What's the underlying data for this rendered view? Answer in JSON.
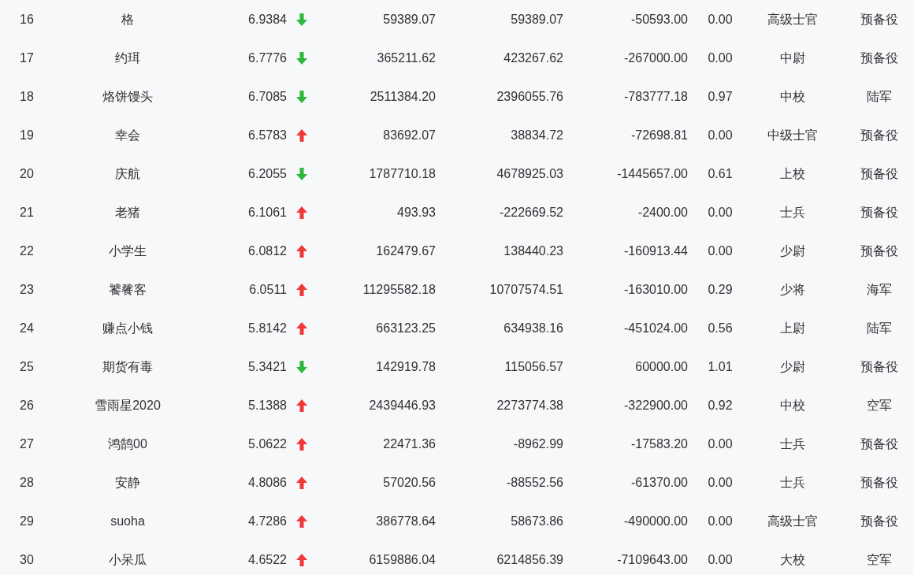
{
  "rows": [
    {
      "rank": "16",
      "name": "格",
      "score": "6.9384",
      "rising": false,
      "column_4": "59389.07",
      "column_5": "59389.07",
      "column_6": "-50593.00",
      "column_7": "0.00",
      "column_8": "高级士官",
      "column_9": "预备役"
    },
    {
      "rank": "17",
      "name": "约珥",
      "score": "6.7776",
      "rising": false,
      "column_4": "365211.62",
      "column_5": "423267.62",
      "column_6": "-267000.00",
      "column_7": "0.00",
      "column_8": "中尉",
      "column_9": "预备役"
    },
    {
      "rank": "18",
      "name": "烙饼馒头",
      "score": "6.7085",
      "rising": false,
      "column_4": "2511384.20",
      "column_5": "2396055.76",
      "column_6": "-783777.18",
      "column_7": "0.97",
      "column_8": "中校",
      "column_9": "陆军"
    },
    {
      "rank": "19",
      "name": "幸会",
      "score": "6.5783",
      "rising": true,
      "column_4": "83692.07",
      "column_5": "38834.72",
      "column_6": "-72698.81",
      "column_7": "0.00",
      "column_8": "中级士官",
      "column_9": "预备役"
    },
    {
      "rank": "20",
      "name": "庆航",
      "score": "6.2055",
      "rising": false,
      "column_4": "1787710.18",
      "column_5": "4678925.03",
      "column_6": "-1445657.00",
      "column_7": "0.61",
      "column_8": "上校",
      "column_9": "预备役"
    },
    {
      "rank": "21",
      "name": "老猪",
      "score": "6.1061",
      "rising": true,
      "column_4": "493.93",
      "column_5": "-222669.52",
      "column_6": "-2400.00",
      "column_7": "0.00",
      "column_8": "士兵",
      "column_9": "预备役"
    },
    {
      "rank": "22",
      "name": "小学生",
      "score": "6.0812",
      "rising": true,
      "column_4": "162479.67",
      "column_5": "138440.23",
      "column_6": "-160913.44",
      "column_7": "0.00",
      "column_8": "少尉",
      "column_9": "预备役"
    },
    {
      "rank": "23",
      "name": "饕餮客",
      "score": "6.0511",
      "rising": true,
      "column_4": "11295582.18",
      "column_5": "10707574.51",
      "column_6": "-163010.00",
      "column_7": "0.29",
      "column_8": "少将",
      "column_9": "海军"
    },
    {
      "rank": "24",
      "name": "赚点小钱",
      "score": "5.8142",
      "rising": true,
      "column_4": "663123.25",
      "column_5": "634938.16",
      "column_6": "-451024.00",
      "column_7": "0.56",
      "column_8": "上尉",
      "column_9": "陆军"
    },
    {
      "rank": "25",
      "name": "期货有毒",
      "score": "5.3421",
      "rising": false,
      "column_4": "142919.78",
      "column_5": "115056.57",
      "column_6": "60000.00",
      "column_7": "1.01",
      "column_8": "少尉",
      "column_9": "预备役"
    },
    {
      "rank": "26",
      "name": "雪雨星2020",
      "score": "5.1388",
      "rising": true,
      "column_4": "2439446.93",
      "column_5": "2273774.38",
      "column_6": "-322900.00",
      "column_7": "0.92",
      "column_8": "中校",
      "column_9": "空军"
    },
    {
      "rank": "27",
      "name": "鸿鹄00",
      "score": "5.0622",
      "rising": true,
      "column_4": "22471.36",
      "column_5": "-8962.99",
      "column_6": "-17583.20",
      "column_7": "0.00",
      "column_8": "士兵",
      "column_9": "预备役"
    },
    {
      "rank": "28",
      "name": "安静",
      "score": "4.8086",
      "rising": true,
      "column_4": "57020.56",
      "column_5": "-88552.56",
      "column_6": "-61370.00",
      "column_7": "0.00",
      "column_8": "士兵",
      "column_9": "预备役"
    },
    {
      "rank": "29",
      "name": "suoha",
      "score": "4.7286",
      "rising": true,
      "column_4": "386778.64",
      "column_5": "58673.86",
      "column_6": "-490000.00",
      "column_7": "0.00",
      "column_8": "高级士官",
      "column_9": "预备役"
    },
    {
      "rank": "30",
      "name": "小呆瓜",
      "score": "4.6522",
      "rising": true,
      "column_4": "6159886.04",
      "column_5": "6214856.39",
      "column_6": "-7109643.00",
      "column_7": "0.00",
      "column_8": "大校",
      "column_9": "空军"
    }
  ]
}
